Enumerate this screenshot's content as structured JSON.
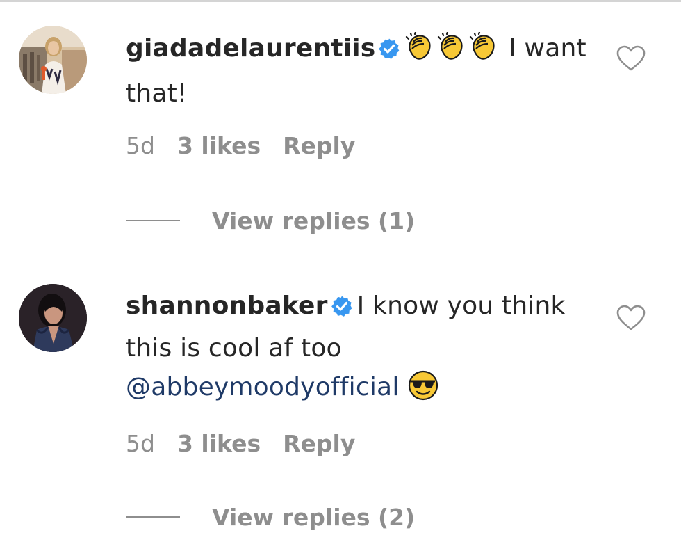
{
  "comments": [
    {
      "username": "giadadelaurentiis",
      "verified": true,
      "text": "I want that!",
      "emojis": [
        "clapping-hands",
        "clapping-hands",
        "clapping-hands"
      ],
      "time": "5d",
      "likes": "3 likes",
      "reply_label": "Reply",
      "view_replies": "View replies (1)",
      "like_icon": "heart-outline"
    },
    {
      "username": "shannonbaker",
      "verified": true,
      "text": "I know you think this is cool af too",
      "mention": "@abbeymoodyofficial",
      "emojis": [
        "smiling-face-with-sunglasses"
      ],
      "time": "5d",
      "likes": "3 likes",
      "reply_label": "Reply",
      "view_replies": "View replies (2)",
      "like_icon": "heart-outline"
    }
  ],
  "colors": {
    "text": "#262626",
    "muted": "#8e8e8e",
    "verified": "#3897f0",
    "mention": "#1f3a67",
    "emoji_yellow": "#f7c836"
  }
}
